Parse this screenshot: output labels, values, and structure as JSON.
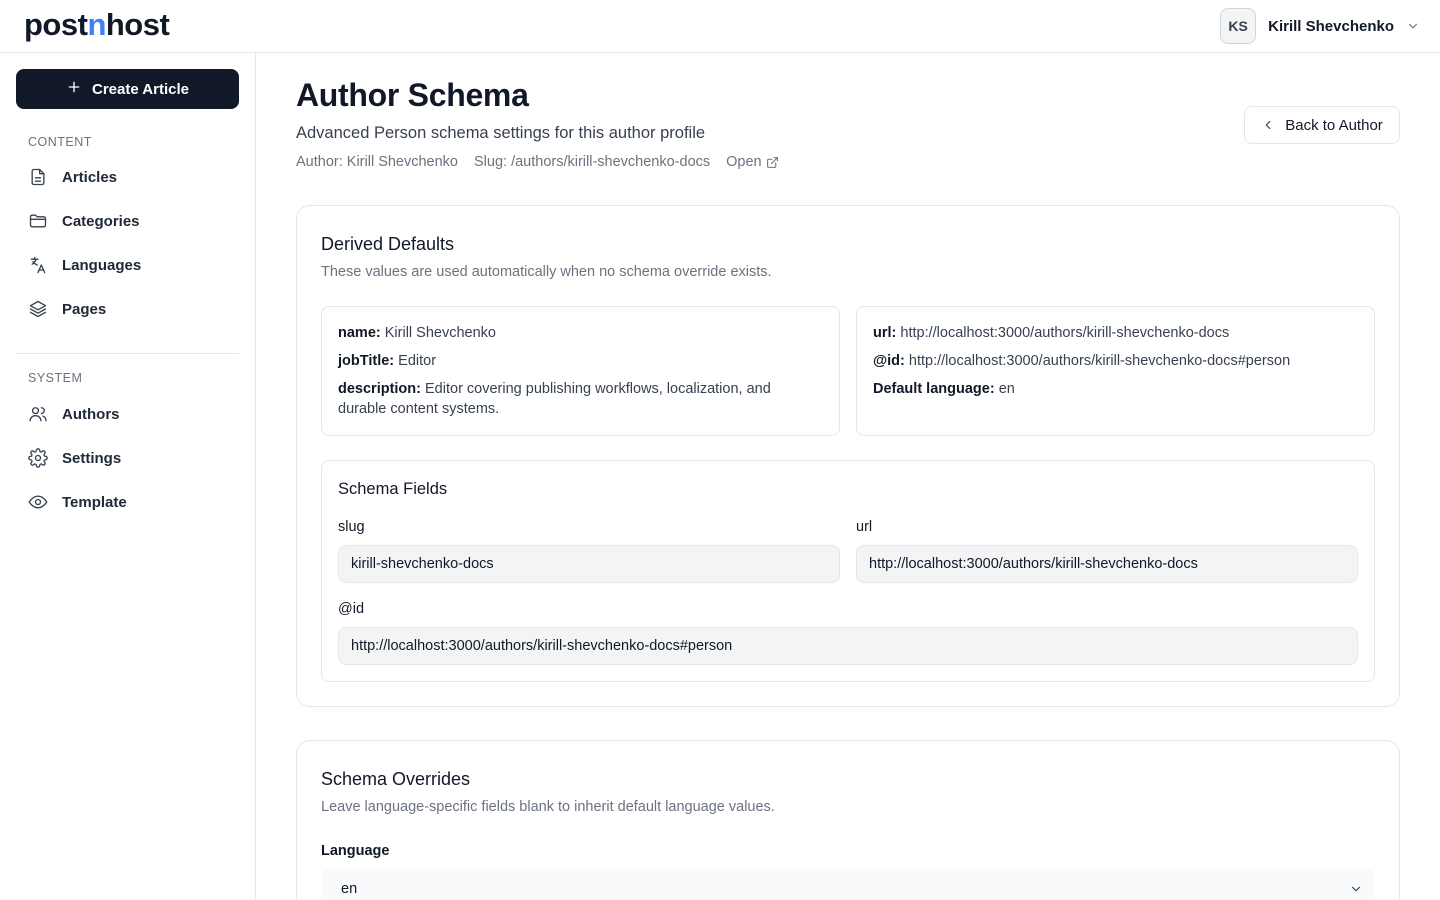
{
  "app": {
    "logo_parts": [
      "post",
      "n",
      "host"
    ],
    "accent_color": "#3b82f6"
  },
  "user": {
    "initials": "KS",
    "name": "Kirill Shevchenko"
  },
  "sidebar": {
    "create_label": "Create Article",
    "content_label": "CONTENT",
    "system_label": "SYSTEM",
    "content_items": [
      {
        "label": "Articles",
        "icon": "document-icon"
      },
      {
        "label": "Categories",
        "icon": "folder-icon"
      },
      {
        "label": "Languages",
        "icon": "translate-icon"
      },
      {
        "label": "Pages",
        "icon": "layers-icon"
      }
    ],
    "system_items": [
      {
        "label": "Authors",
        "icon": "users-icon"
      },
      {
        "label": "Settings",
        "icon": "gear-icon"
      },
      {
        "label": "Template",
        "icon": "eye-icon"
      }
    ]
  },
  "header": {
    "title": "Author Schema",
    "subtitle": "Advanced Person schema settings for this author profile",
    "author_meta": "Author: Kirill Shevchenko",
    "slug_meta": "Slug: /authors/kirill-shevchenko-docs",
    "open_label": "Open",
    "back_label": "Back to Author"
  },
  "derived": {
    "title": "Derived Defaults",
    "description": "These values are used automatically when no schema override exists.",
    "left": [
      {
        "key": "name:",
        "value": "Kirill Shevchenko"
      },
      {
        "key": "jobTitle:",
        "value": "Editor"
      },
      {
        "key": "description:",
        "value": "Editor covering publishing workflows, localization, and durable content systems."
      }
    ],
    "right": [
      {
        "key": "url:",
        "value": "http://localhost:3000/authors/kirill-shevchenko-docs"
      },
      {
        "key": "@id:",
        "value": "http://localhost:3000/authors/kirill-shevchenko-docs#person"
      },
      {
        "key": "Default language:",
        "value": "en"
      }
    ]
  },
  "fields": {
    "title": "Schema Fields",
    "slug_label": "slug",
    "slug_value": "kirill-shevchenko-docs",
    "url_label": "url",
    "url_value": "http://localhost:3000/authors/kirill-shevchenko-docs",
    "id_label": "@id",
    "id_value": "http://localhost:3000/authors/kirill-shevchenko-docs#person"
  },
  "overrides": {
    "title": "Schema Overrides",
    "description": "Leave language-specific fields blank to inherit default language values.",
    "language_label": "Language",
    "language_value": "en"
  }
}
